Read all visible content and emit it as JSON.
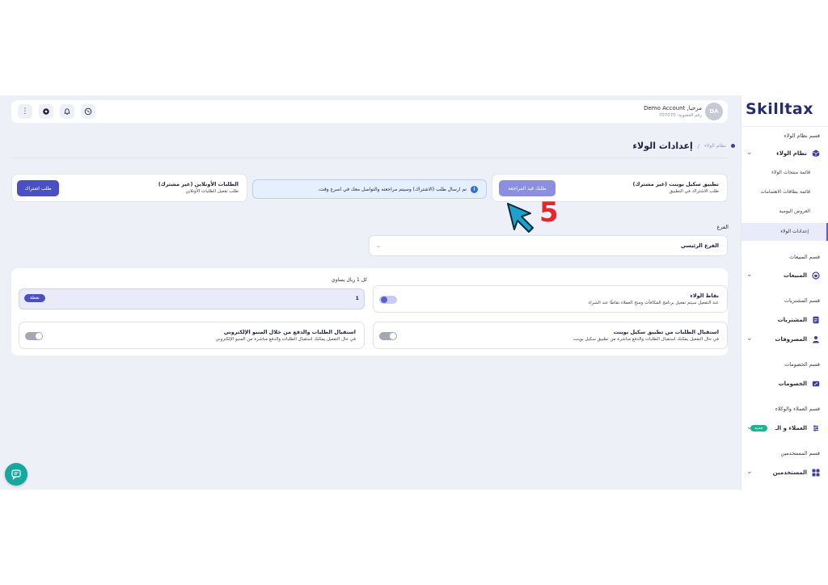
{
  "sidebar": {
    "logo": "Skilltax",
    "items": [
      {
        "type": "section",
        "label": "قسم نظام الولاء"
      },
      {
        "type": "group",
        "label": "نظام الولاء",
        "icon": "cube-icon"
      },
      {
        "type": "sub",
        "label": "قائمة منتجات الولاء"
      },
      {
        "type": "sub",
        "label": "قائمة بطاقات الاهتمامات"
      },
      {
        "type": "sub",
        "label": "العروض اليومية"
      },
      {
        "type": "sub",
        "label": "إعدادات الولاء",
        "active": true
      },
      {
        "type": "section",
        "label": "قسم المبيعات"
      },
      {
        "type": "group",
        "label": "المبيعات",
        "icon": "basket-icon"
      },
      {
        "type": "section",
        "label": "قسم المشتريات"
      },
      {
        "type": "group",
        "label": "المشتريات",
        "icon": "doc-icon"
      },
      {
        "type": "group",
        "label": "المصروفات",
        "icon": "users-icon"
      },
      {
        "type": "section",
        "label": "قسم الخصومات"
      },
      {
        "type": "group",
        "label": "الخصومات",
        "icon": "tag-icon"
      },
      {
        "type": "section",
        "label": "قسم العملاء والوكلاء"
      },
      {
        "type": "group",
        "label": "العملاء و الـ",
        "icon": "people-icon",
        "badge": "جديد"
      },
      {
        "type": "section",
        "label": "قسم المستخدمين"
      },
      {
        "type": "group",
        "label": "المستخدمين",
        "icon": "grid-icon"
      }
    ]
  },
  "header": {
    "account_name": "مرحبا, Demo Account",
    "account_sub": "رقم العضوية: 707070",
    "avatar": "DA"
  },
  "breadcrumb": {
    "parent": "نظام الولاء",
    "separator": "/",
    "title": "إعدادات الولاء"
  },
  "subscription": {
    "skill_card": {
      "title": "تطبيق سكيل بوينت (غير مشترك)",
      "subtitle": "طلب الاشتراك في التطبيق",
      "button": "طلبك قيد المراجعة"
    },
    "info": "تم ارسال طلب (الاشتراك) وسيتم مراجعته والتواصل معك في اسرع وقت.",
    "online_card": {
      "title": "الطلبات الأونلاين (غير مشترك)",
      "subtitle": "طلب تفعيل الطلبات الأونلاين",
      "button": "طلب اشتراك"
    }
  },
  "branch": {
    "label": "الفرع",
    "value": "الفرع الرئيسي"
  },
  "settings": {
    "loyalty_points": {
      "title": "نقاط الولاء",
      "subtitle": "عند التفعيل سيتم تفعيل برنامج المكافآت ومنح العملاء نقاطًا عند الشراء",
      "enabled": true
    },
    "riyal_label": "كل 1 ريال يساوي",
    "points_value": "1",
    "points_unit": "نقطة",
    "skill_orders": {
      "title": "استقبال الطلبات من تطبيق سكيل بوينت",
      "subtitle": "في حال التفعيل يمكنك استقبال الطلبات والدفع مباشرة من تطبيق سكيل بوينت",
      "enabled": false
    },
    "menu_orders": {
      "title": "استقبال الطلبات والدفع من خلال المنيو الإلكتروني",
      "subtitle": "في حال التفعيل يمكنك استقبال الطلبات والدفع مباشرة من المنيو الإلكتروني",
      "enabled": false
    }
  },
  "annotation": {
    "step": "5",
    "color": "#e5262a"
  },
  "colors": {
    "primary": "#4b4fc4",
    "accent_teal": "#15a7a0",
    "background": "#eef0f8"
  }
}
